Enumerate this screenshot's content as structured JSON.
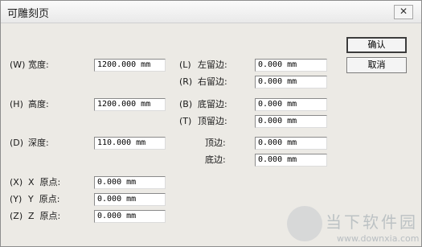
{
  "dialog": {
    "title": "可雕刻页",
    "close_glyph": "✕"
  },
  "buttons": {
    "ok": "确认",
    "cancel": "取消"
  },
  "size": {
    "width": {
      "key": "(W)",
      "label": "宽度:",
      "value": "1200.000 mm"
    },
    "height": {
      "key": "(H)",
      "label": "高度:",
      "value": "1200.000 mm"
    },
    "depth": {
      "key": "(D)",
      "label": "深度:",
      "value": "110.000 mm"
    }
  },
  "margins": {
    "left": {
      "key": "(L)",
      "label": "左留边:",
      "value": "0.000 mm"
    },
    "right": {
      "key": "(R)",
      "label": "右留边:",
      "value": "0.000 mm"
    },
    "bottom": {
      "key": "(B)",
      "label": "底留边:",
      "value": "0.000 mm"
    },
    "top": {
      "key": "(T)",
      "label": "顶留边:",
      "value": "0.000 mm"
    },
    "top_edge": {
      "label": "顶边:",
      "value": "0.000 mm"
    },
    "bottom_edge": {
      "label": "底边:",
      "value": "0.000 mm"
    }
  },
  "origin": {
    "x": {
      "key": "(X)",
      "label": "X  原点:",
      "value": "0.000 mm"
    },
    "y": {
      "key": "(Y)",
      "label": "Y  原点:",
      "value": "0.000 mm"
    },
    "z": {
      "key": "(Z)",
      "label": "Z  原点:",
      "value": "0.000 mm"
    }
  },
  "watermark": {
    "brand": "当下软件园",
    "url": "www.downxia.com"
  }
}
